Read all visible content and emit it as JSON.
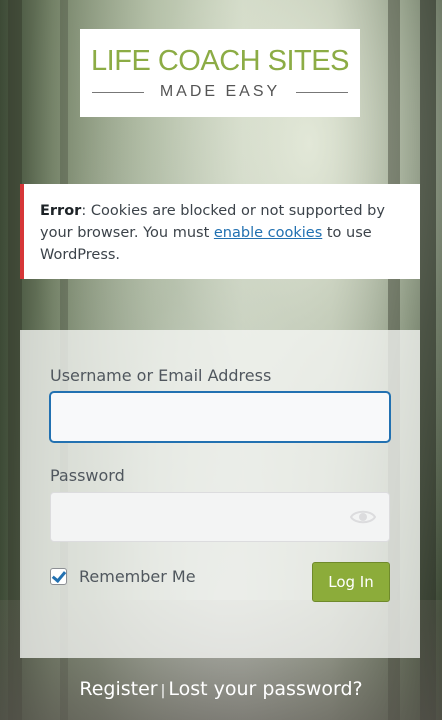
{
  "logo": {
    "line1": "LIFE COACH SITES",
    "line2": "MADE EASY"
  },
  "error": {
    "label": "Error",
    "message_before": ": Cookies are blocked or not supported by your browser. You must ",
    "link": "enable cookies",
    "message_after": " to use WordPress."
  },
  "form": {
    "username_label": "Username or Email Address",
    "username_value": "",
    "password_label": "Password",
    "password_value": "",
    "remember_label": "Remember Me",
    "remember_checked": true,
    "login_label": "Log In"
  },
  "links": {
    "register": "Register",
    "separator": "|",
    "lost_password": "Lost your password?"
  },
  "colors": {
    "brand_green": "#8cac3a",
    "error_red": "#d63638",
    "link_blue": "#2271b1"
  }
}
